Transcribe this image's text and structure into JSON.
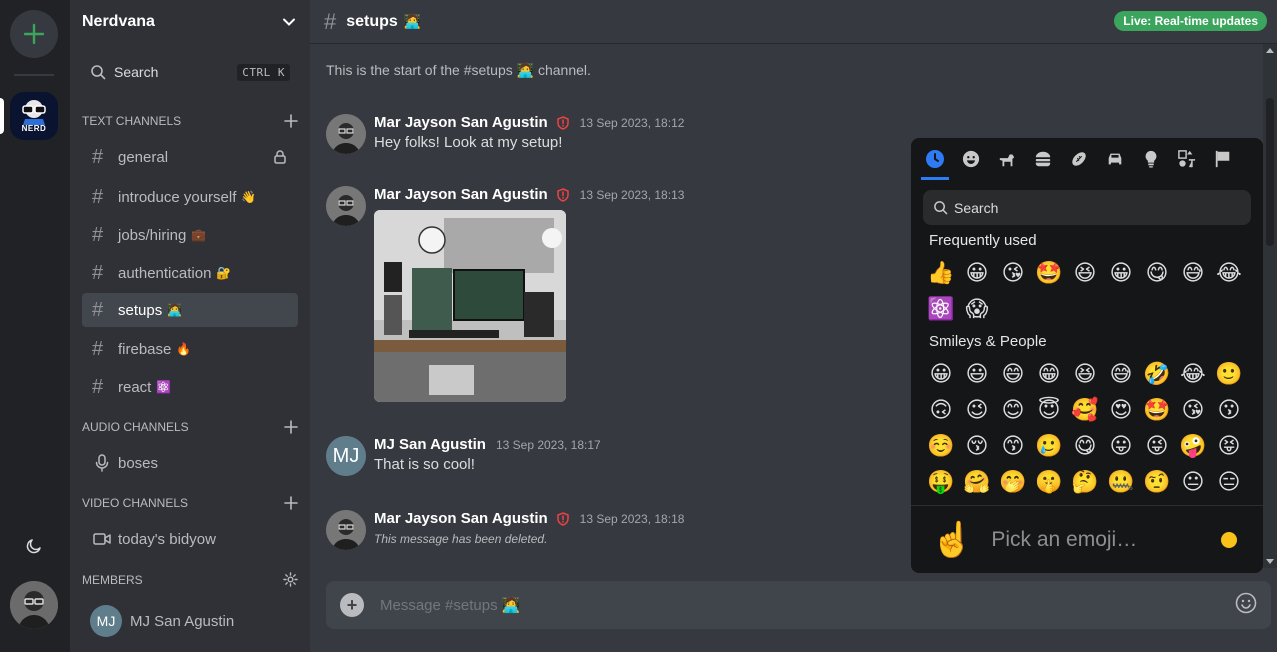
{
  "server": {
    "name": "Nerdvana",
    "logo_text": "NERD"
  },
  "search": {
    "label": "Search",
    "shortcut": "CTRL K"
  },
  "sections": {
    "text": "TEXT CHANNELS",
    "audio": "AUDIO CHANNELS",
    "video": "VIDEO CHANNELS",
    "members": "MEMBERS"
  },
  "text_channels": [
    {
      "name": "general",
      "emoji": ""
    },
    {
      "name": "introduce yourself",
      "emoji": "👋"
    },
    {
      "name": "jobs/hiring",
      "emoji": "💼"
    },
    {
      "name": "authentication",
      "emoji": "🔐"
    },
    {
      "name": "setups",
      "emoji": "🧑‍💻"
    },
    {
      "name": "firebase",
      "emoji": "🔥"
    },
    {
      "name": "react",
      "emoji": "⚛️"
    }
  ],
  "audio_channels": [
    {
      "name": "boses"
    }
  ],
  "video_channels": [
    {
      "name": "today's bidyow"
    }
  ],
  "members": [
    {
      "name": "MJ San Agustin",
      "initials": "MJ"
    }
  ],
  "header": {
    "channel": "setups",
    "channel_emoji": "🧑‍💻",
    "live_badge": "Live: Real-time updates"
  },
  "intro": "This is the start of the #setups 🧑‍💻 channel.",
  "messages": [
    {
      "author": "Mar Jayson San Agustin",
      "time": "13 Sep 2023, 18:12",
      "text": "Hey folks! Look at my setup!"
    },
    {
      "author": "Mar Jayson San Agustin",
      "time": "13 Sep 2023, 18:13",
      "text": ""
    },
    {
      "author": "MJ San Agustin",
      "initials": "MJ",
      "time": "13 Sep 2023, 18:17",
      "text": "That is so cool!"
    },
    {
      "author": "Mar Jayson San Agustin",
      "time": "13 Sep 2023, 18:18",
      "text": "This message has been deleted."
    }
  ],
  "composer": {
    "placeholder": "Message #setups 🧑‍💻"
  },
  "emoji_picker": {
    "search_placeholder": "Search",
    "frequent_title": "Frequently used",
    "frequent": [
      "👍",
      "😀",
      "😘",
      "🤩",
      "😆",
      "😀",
      "😋",
      "😅",
      "😂",
      "⚛️",
      "😱"
    ],
    "smileys_title": "Smileys & People",
    "smileys": [
      "😀",
      "😃",
      "😄",
      "😁",
      "😆",
      "😅",
      "🤣",
      "😂",
      "🙂",
      "🙃",
      "😉",
      "😊",
      "😇",
      "🥰",
      "😍",
      "🤩",
      "😘",
      "😗",
      "☺️",
      "😚",
      "😙",
      "🥲",
      "😋",
      "😛",
      "😜",
      "🤪",
      "😝",
      "🤑",
      "🤗",
      "🤭",
      "🤫",
      "🤔",
      "🤐",
      "🤨",
      "😐",
      "😑"
    ],
    "footer_emoji": "☝️",
    "footer_text": "Pick an emoji…"
  }
}
